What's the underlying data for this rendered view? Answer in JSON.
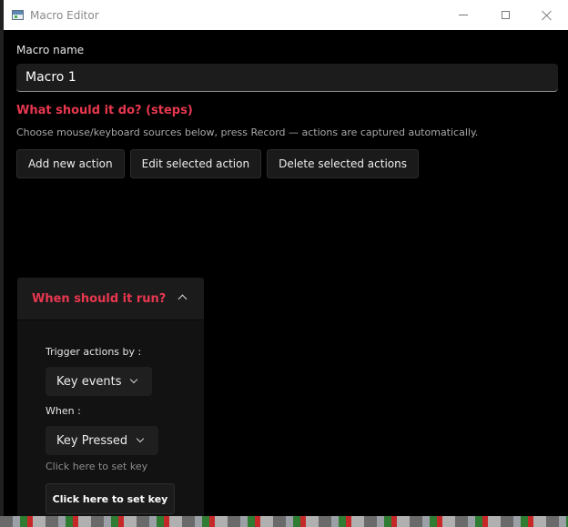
{
  "window": {
    "title": "Macro Editor"
  },
  "macro_name": {
    "label": "Macro name",
    "value": "Macro 1"
  },
  "steps": {
    "title": "What should it do? (steps)",
    "help": "Choose mouse/keyboard sources below, press Record — actions are captured automatically.",
    "buttons": {
      "add": "Add new action",
      "edit": "Edit selected action",
      "delete": "Delete selected actions"
    }
  },
  "trigger": {
    "title": "When should it run?",
    "trigger_label": "Trigger actions by :",
    "trigger_value": "Key events",
    "when_label": "When :",
    "when_value": "Key Pressed",
    "hint": "Click here to set key",
    "set_key_button": "Click here to set key"
  },
  "colors": {
    "accent": "#e8374f",
    "background": "#000000",
    "control": "#1c1c1c"
  },
  "icons": {
    "app": "app-window-icon",
    "minimize": "minimize-icon",
    "maximize": "maximize-icon",
    "close": "close-icon",
    "collapse": "chevron-up-icon",
    "dropdown": "chevron-down-icon"
  }
}
